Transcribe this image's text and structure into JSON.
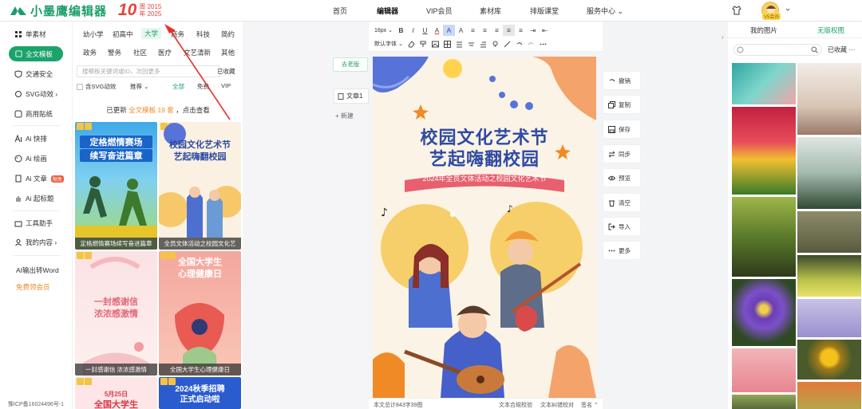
{
  "brand": {
    "logo_text": "小墨鹰编辑器",
    "anniv_num": "10",
    "anniv_top": "周 2015",
    "anniv_bottom": "年 2025"
  },
  "nav": [
    "首页",
    "编辑器",
    "VIP会员",
    "素材库",
    "排版课堂",
    "服务中心 ⌄"
  ],
  "user": {
    "vip_label": "V5会员"
  },
  "left_nav": {
    "items": [
      "单素材",
      "全文模板",
      "交通安全",
      "SVG动效 ›",
      "商用贴纸",
      "Ai 快排",
      "Ai 绘画",
      "Ai 文章",
      "Ai 起标题",
      "工具助手",
      "我的内容 ›"
    ],
    "new_badge": "限免",
    "ai_word": "AI输出转Word",
    "free_member": "免费领会员"
  },
  "icp": "豫ICP备16024496号-1",
  "template_panel": {
    "categories_row1": [
      "幼小学",
      "初高中",
      "大学",
      "商务",
      "科技",
      "简约"
    ],
    "categories_row2": [
      "政务",
      "警务",
      "社区",
      "医疗",
      "文艺清新",
      "其他"
    ],
    "active_category": "大学",
    "search_placeholder": "搜模板关键词或ID，次回更多",
    "collect": "已收藏",
    "svg_check": "含SVG动效",
    "sort": "推荐 ⌄",
    "filters": [
      "全部",
      "免费",
      "VIP"
    ],
    "updated_prefix": "已更新",
    "updated_highlight": "全文模板 19 套",
    "updated_suffix": "，点击查看",
    "cards": [
      {
        "title_line1": "定格燃情赛场",
        "title_line2": "续写奋进篇章",
        "caption": "定格燃情赛场续写奋进篇章"
      },
      {
        "title_line1": "校园文化艺术节",
        "title_line2": "艺起嗨翻校园",
        "caption": "全员文体活动之校园文化艺"
      },
      {
        "title_line1": "一封感谢信",
        "title_line2": "浓浓感激情",
        "caption": "一封感谢信 浓浓感激情"
      },
      {
        "title_line1": "全国大学生",
        "title_line2": "心理健康日",
        "caption": "全国大学生心理健康日"
      },
      {
        "title_line1": "5月25日",
        "title_line2": "全国大学生",
        "caption": ""
      },
      {
        "title_line1": "2024秋季招聘",
        "title_line2": "正式启动啦",
        "caption": ""
      }
    ]
  },
  "doc_tabs": {
    "old_version": "去老版",
    "current": "文章1",
    "new": "+ 新建"
  },
  "toolbar": {
    "row1": [
      "16px ⌄",
      "B",
      "I",
      "U",
      "A",
      "A",
      "A",
      "≡",
      "≡",
      "≡",
      "≡",
      "≡",
      "⇥",
      "⇤"
    ],
    "row2_font": "默认字体 ⌄"
  },
  "poster": {
    "title1": "校园文化艺术节",
    "title2": "艺起嗨翻校园",
    "ribbon": "2024年全员文体活动之校园文化艺术节"
  },
  "statusbar": {
    "count": "本文总计843字39图",
    "check": "文本合规校验",
    "proof": "文本纠错校对",
    "sign": "签名 ⌃"
  },
  "side_actions": [
    "撤销",
    "复制",
    "保存",
    "同步",
    "预览",
    "清空",
    "导入",
    "更多"
  ],
  "right_panel": {
    "tab_mine": "我的图片",
    "tab_free": "无版权图",
    "collect": "已收藏",
    "more": "···"
  },
  "colors": {
    "brand_green": "#1aa36a",
    "poster_blue": "#2e4aa3",
    "accent_orange": "#f08a24",
    "anniv_red": "#e4433a"
  }
}
